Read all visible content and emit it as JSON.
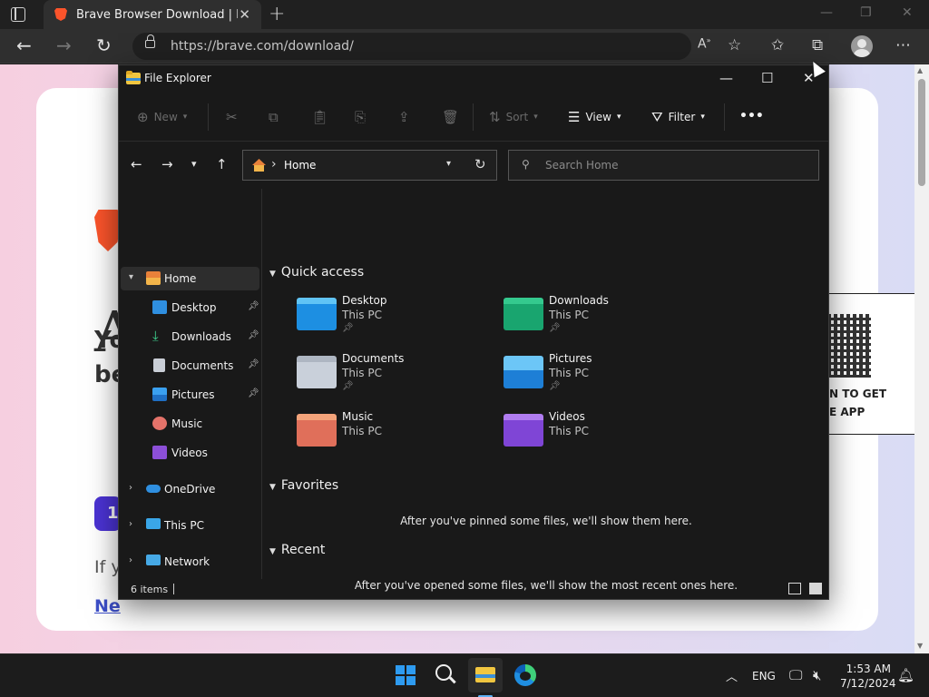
{
  "browser": {
    "tab_title": "Brave Browser Download | Brave",
    "url": "https://brave.com/download/",
    "icons": [
      "tab-actions-icon",
      "brave-favicon",
      "close-icon",
      "new-tab-icon",
      "back-icon",
      "forward-icon",
      "refresh-icon",
      "lock-icon",
      "read-aloud-icon",
      "add-favorite-icon",
      "favorites-icon",
      "collections-icon",
      "profile-avatar",
      "more-icon"
    ]
  },
  "webpage": {
    "big_letter": "A",
    "heading_line1": "Yo",
    "heading_line2": "be",
    "step_number": "1",
    "if_text": "If y",
    "link_text": "Ne",
    "qr_line1": "N TO GET",
    "qr_line2": "E APP"
  },
  "explorer": {
    "title": "File Explorer",
    "toolbar": {
      "new": "New",
      "sort": "Sort",
      "view": "View",
      "filter": "Filter",
      "more": "•••"
    },
    "path": "Home",
    "search_placeholder": "Search Home",
    "nav": {
      "home": "Home",
      "desktop": "Desktop",
      "downloads": "Downloads",
      "documents": "Documents",
      "pictures": "Pictures",
      "music": "Music",
      "videos": "Videos",
      "onedrive": "OneDrive",
      "thispc": "This PC",
      "network": "Network"
    },
    "quick_access": {
      "heading": "Quick access",
      "items": [
        {
          "name": "Desktop",
          "location": "This PC",
          "pinned": true
        },
        {
          "name": "Downloads",
          "location": "This PC",
          "pinned": true
        },
        {
          "name": "Documents",
          "location": "This PC",
          "pinned": true
        },
        {
          "name": "Pictures",
          "location": "This PC",
          "pinned": true
        },
        {
          "name": "Music",
          "location": "This PC",
          "pinned": false
        },
        {
          "name": "Videos",
          "location": "This PC",
          "pinned": false
        }
      ]
    },
    "favorites": {
      "heading": "Favorites",
      "empty": "After you've pinned some files, we'll show them here."
    },
    "recent": {
      "heading": "Recent",
      "empty": "After you've opened some files, we'll show the most recent ones here."
    },
    "status": "6 items"
  },
  "taskbar": {
    "lang": "ENG",
    "time": "1:53 AM",
    "date": "7/12/2024"
  },
  "colors": {
    "accent": "#2e9bf0",
    "brave_orange": "#fb542b",
    "explorer_bg": "#191919"
  }
}
